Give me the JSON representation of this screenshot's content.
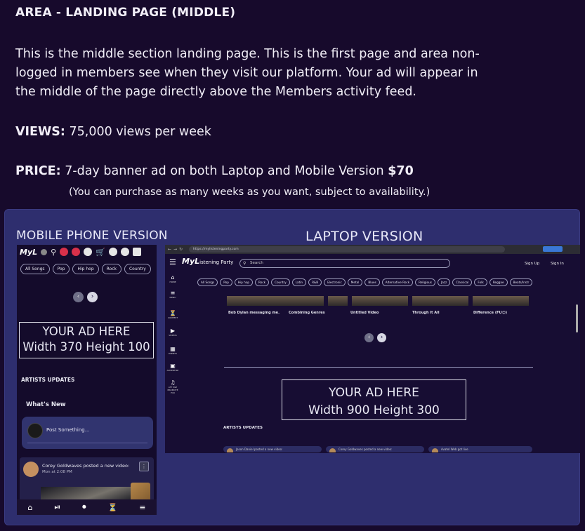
{
  "heading": "AREA - LANDING PAGE (MIDDLE)",
  "description": "This is the middle section landing page. This is the first page and area non-logged in members see when they visit our platform. Your ad will appear in the middle of the page directly above the Members activity feed.",
  "views": {
    "label": "VIEWS:",
    "value": "75,000 views per week"
  },
  "price": {
    "label": "PRICE:",
    "text": "7-day banner ad on both Laptop and Mobile Version",
    "amount": "$70"
  },
  "note": "(You can purchase as many weeks as you want, subject to availability.)",
  "mobile": {
    "title": "MOBILE PHONE VERSION",
    "logo": "MyL",
    "genres": [
      "All Songs",
      "Pop",
      "Hip hop",
      "Rock",
      "Country"
    ],
    "prev_arrow": "‹",
    "next_arrow": "›",
    "ad_line1": "YOUR AD HERE",
    "ad_line2": "Width 370 Height 100",
    "artists_updates": "ARTISTS UPDATES",
    "whats_new": "What's New",
    "post_placeholder": "Post Something...",
    "feed_name": "Corey Goldwaves posted a new video:",
    "feed_time": "Mon at 2:08 PM",
    "nav": [
      "⌂",
      "⏯",
      "⏺",
      "⏳",
      "≡"
    ]
  },
  "laptop": {
    "title": "LAPTOP VERSION",
    "url": "https://mylisteningparty.com",
    "logo_main": "MyL",
    "logo_rest": "istening Party",
    "search_placeholder": "Search",
    "sign_up": "Sign Up",
    "sign_in": "Sign In",
    "sidebar": [
      {
        "icon": "⌂",
        "label": "HOME"
      },
      {
        "icon": "≡",
        "label": "MENU"
      },
      {
        "icon": "⏳",
        "label": "CONTEST"
      },
      {
        "icon": "▶",
        "label": "VIDEOS"
      },
      {
        "icon": "▦",
        "label": "EVENTS"
      },
      {
        "icon": "▣",
        "label": "ADVERTISE"
      },
      {
        "icon": "♫",
        "label": "LET MLP PROMOTE YOU"
      }
    ],
    "genres": [
      "All Songs",
      "Pop",
      "Hip hop",
      "Rock",
      "Country",
      "Latin",
      "R&B",
      "Electronic",
      "Metal",
      "Blues",
      "Alternative Rock",
      "Religious",
      "Jazz",
      "Classical",
      "Folk",
      "Reggae",
      "Beats/Instr"
    ],
    "videos": [
      "Bob Dylan messaging me.",
      "Combining Genres",
      "Untitled Video",
      "Through It All",
      "Difference (FU😊)"
    ],
    "prev_arrow": "‹",
    "next_arrow": "›",
    "ad_line1": "YOUR AD HERE",
    "ad_line2": "Width 900 Height 300",
    "artists_updates": "ARTISTS UPDATES",
    "cards": [
      "Jason Daniel posted a new video:",
      "Corey Goldwaves posted a new video:",
      "Avatel Web got live"
    ]
  }
}
